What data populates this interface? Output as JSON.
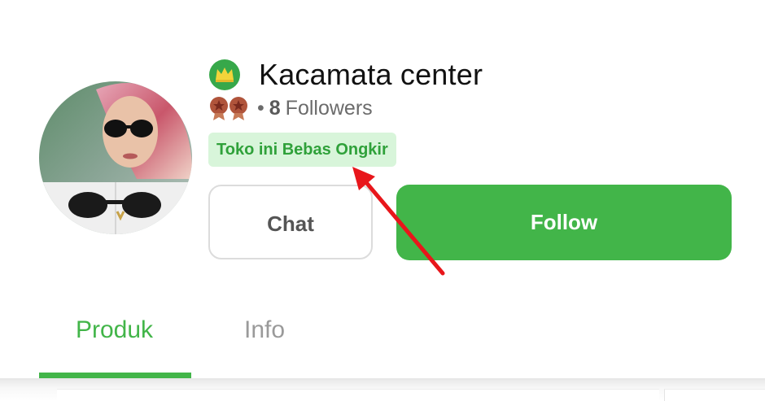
{
  "shop": {
    "name": "Kacamata center",
    "badge_icon": "crown-badge-icon",
    "rating_icon": "medal-icon",
    "followers_bullet": "•",
    "followers_count": "8",
    "followers_label": "Followers",
    "free_shipping_tag": "Toko ini Bebas Ongkir"
  },
  "actions": {
    "chat_label": "Chat",
    "follow_label": "Follow"
  },
  "tabs": [
    {
      "label": "Produk",
      "active": true
    },
    {
      "label": "Info",
      "active": false
    }
  ],
  "colors": {
    "brand_green": "#42b549",
    "tag_background": "#d8f5da",
    "annotation_red": "#e8161b"
  }
}
